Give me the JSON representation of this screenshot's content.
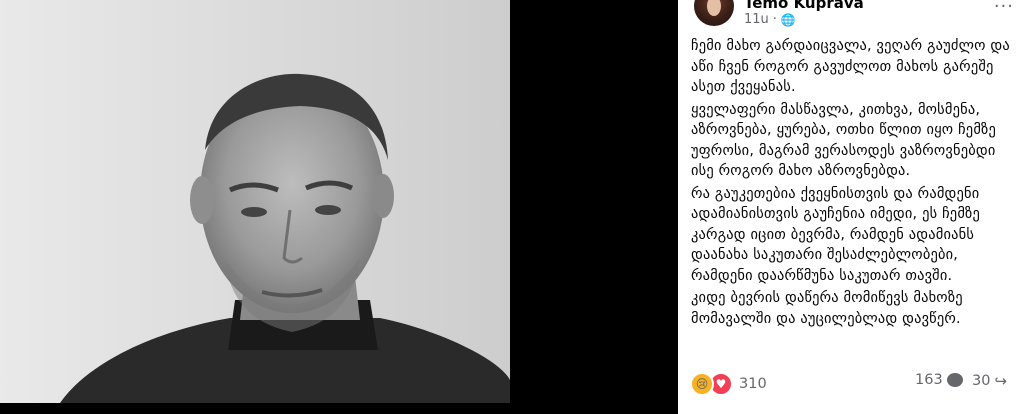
{
  "post": {
    "author": "Temo Kuprava",
    "time": "11u",
    "visibility_icon": "globe-icon",
    "paragraphs": [
      "ჩემი მახო გარდაიცვალა, ვეღარ გაუძლო და აწი ჩვენ როგორ გავუძლოთ მახოს გარეშე ასეთ ქვეყანას.",
      "ყველაფერი მასწავლა, კითხვა, მოსმენა, აზროვნება, ყურება, ოთხი წლით იყო ჩემზე უფროსი, მაგრამ ვერასოდეს ვაზროვნებდი ისე როგორ მახო აზროვნებდა.",
      "რა გაუკეთებია ქვეყნისთვის და რამდენი ადამიანისთვის გაუჩენია იმედი, ეს ჩემზე კარგად იცით ბევრმა, რამდენ ადამიანს დაანახა საკუთარი შესაძლებლობები, რამდენი დაარწმუნა საკუთარ თავში.",
      "კიდე ბევრის დაწერა მომიწევს მახოზე მომავალში და აუცილებლად დავწერ."
    ]
  },
  "footer": {
    "reaction_count": "310",
    "comment_count": "163",
    "share_count": "30",
    "reaction_icons": [
      "sad-reaction-icon",
      "love-reaction-icon"
    ]
  }
}
